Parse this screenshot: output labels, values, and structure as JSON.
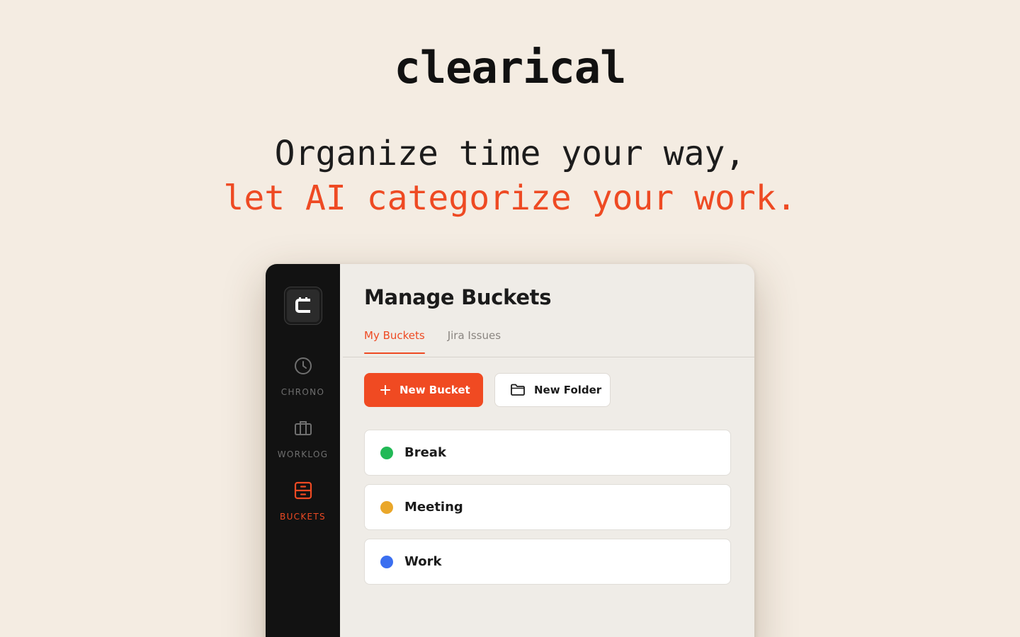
{
  "brand": {
    "name": "clearical"
  },
  "headline": {
    "line1": "Organize time your way,",
    "line2": "let AI categorize your work."
  },
  "sidebar": {
    "logo_icon": "clearical-c-icon",
    "items": [
      {
        "label": "CHRONO",
        "icon": "clock-icon",
        "active": false
      },
      {
        "label": "WORKLOG",
        "icon": "briefcase-icon",
        "active": false
      },
      {
        "label": "BUCKETS",
        "icon": "bucket-drawer-icon",
        "active": true
      }
    ]
  },
  "main": {
    "title": "Manage Buckets",
    "tabs": [
      {
        "label": "My Buckets",
        "active": true
      },
      {
        "label": "Jira Issues",
        "active": false
      }
    ],
    "toolbar": {
      "new_bucket_label": "New Bucket",
      "new_folder_label": "New Folder"
    },
    "buckets": [
      {
        "name": "Break",
        "color": "#22b956"
      },
      {
        "name": "Meeting",
        "color": "#eaa72a"
      },
      {
        "name": "Work",
        "color": "#3b6ff0"
      }
    ]
  },
  "colors": {
    "background": "#f4ece2",
    "accent": "#ee4a23",
    "sidebar": "#121212"
  }
}
